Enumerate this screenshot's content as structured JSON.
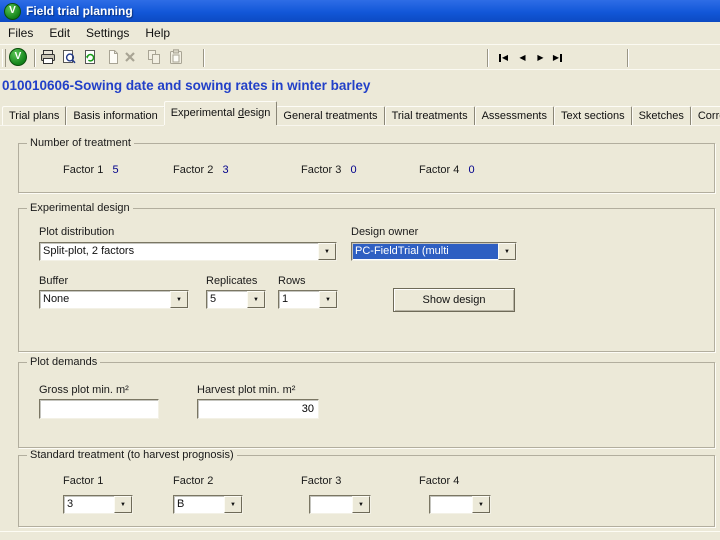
{
  "window": {
    "title": "Field trial planning",
    "icon_letter": "V"
  },
  "menu": {
    "items": [
      "Files",
      "Edit",
      "Settings",
      "Help"
    ]
  },
  "toolbar": {
    "buttons": [
      "exit",
      "print",
      "print-preview",
      "refresh",
      "new",
      "delete",
      "copy",
      "paste"
    ],
    "nav": [
      {
        "name": "first-record",
        "glyph": "◀"
      },
      {
        "name": "previous-record",
        "glyph": "◀"
      },
      {
        "name": "next-record",
        "glyph": "▶"
      },
      {
        "name": "last-record",
        "glyph": "▶"
      }
    ]
  },
  "heading": {
    "title": "010010606-Sowing date and sowing rates in winter barley"
  },
  "tabs": {
    "items": [
      {
        "label": "Trial plans"
      },
      {
        "label": "Basis information"
      },
      {
        "label": "Experimental design",
        "pre": "Experimental ",
        "accel": "d",
        "post": "esign",
        "active": true
      },
      {
        "label": "General treatments"
      },
      {
        "label": "Trial treatments"
      },
      {
        "label": "Assessments"
      },
      {
        "label": "Text sections"
      },
      {
        "label": "Sketches"
      },
      {
        "label": "Corrections"
      }
    ]
  },
  "number_of_treatment": {
    "legend": "Number of treatment",
    "factors": [
      {
        "label": "Factor 1",
        "value": "5"
      },
      {
        "label": "Factor 2",
        "value": "3"
      },
      {
        "label": "Factor 3",
        "value": "0"
      },
      {
        "label": "Factor 4",
        "value": "0"
      }
    ]
  },
  "experimental_design": {
    "legend": "Experimental design",
    "plot_distribution": {
      "label": "Plot distribution",
      "value": "Split-plot, 2 factors"
    },
    "design_owner": {
      "label": "Design owner",
      "value": "PC-FieldTrial (multi",
      "selected": true
    },
    "buffer": {
      "label": "Buffer",
      "value": "None"
    },
    "replicates": {
      "label": "Replicates",
      "value": "5"
    },
    "rows": {
      "label": "Rows",
      "value": "1"
    },
    "show_design_button": "Show design"
  },
  "plot_demands": {
    "legend": "Plot demands",
    "gross_plot": {
      "label": "Gross plot min. m²",
      "value": ""
    },
    "harvest_plot": {
      "label": "Harvest plot min. m²",
      "value": "30"
    }
  },
  "standard_treatment": {
    "legend": "Standard treatment (to harvest prognosis)",
    "factors": [
      {
        "label": "Factor 1",
        "value": "3"
      },
      {
        "label": "Factor 2",
        "value": "B"
      },
      {
        "label": "Factor 3",
        "value": ""
      },
      {
        "label": "Factor 4",
        "value": ""
      }
    ]
  },
  "icons": {
    "combo_arrow": "▼"
  },
  "colors": {
    "titlebar_blue": "#1257d8",
    "heading_text": "#2240c8",
    "selection_blue": "#2e5fc2",
    "window_bg": "#ece9d8",
    "factor_value_navy": "#00008b",
    "logo_green": "#12831a"
  }
}
